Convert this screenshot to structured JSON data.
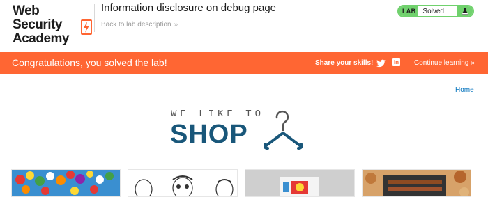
{
  "header": {
    "logo_line1": "Web Security",
    "logo_line2": "Academy",
    "lab_title": "Information disclosure on debug page",
    "back_link": "Back to lab description",
    "back_chevron": "»",
    "status": {
      "badge": "LAB",
      "text": "Solved",
      "icon": "flask-icon"
    }
  },
  "banner": {
    "message": "Congratulations, you solved the lab!",
    "share_label": "Share your skills!",
    "continue_label": "Continue learning",
    "continue_chevron": "»",
    "social_icons": [
      "twitter-icon",
      "linkedin-icon"
    ],
    "linkedin_glyph": "in"
  },
  "nav": {
    "home_link": "Home"
  },
  "brand": {
    "top_text": "WE LIKE TO",
    "shop_text": "SHOP",
    "icon": "hanger-icon"
  },
  "products": [
    {
      "image": "balloons-image"
    },
    {
      "image": "cartoon-faces-image"
    },
    {
      "image": "projector-image"
    },
    {
      "image": "food-grill-image"
    }
  ],
  "colors": {
    "accent": "#ff6633",
    "solved_green": "#70d16d",
    "link_blue": "#0071bc",
    "shop_blue": "#19577a"
  }
}
